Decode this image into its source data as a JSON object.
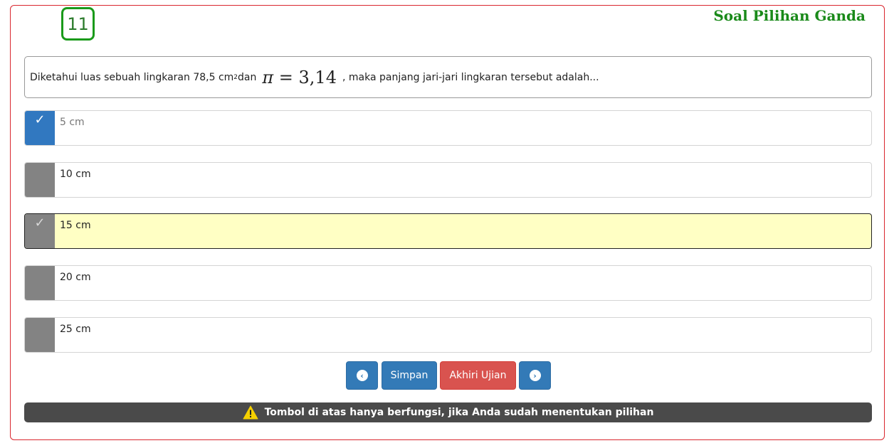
{
  "question_number": "11",
  "page_title": "Soal Pilihan Ganda",
  "question": {
    "text_before": "Diketahui luas sebuah lingkaran 78,5 cm",
    "superscript": "2",
    "text_dan": " dan",
    "math_pi": "π",
    "math_rest": " = 3,14",
    "text_after": ", maka panjang jari-jari lingkaran tersebut adalah..."
  },
  "options": [
    {
      "label": "5 cm",
      "state": "selected"
    },
    {
      "label": "10 cm",
      "state": "normal"
    },
    {
      "label": "15 cm",
      "state": "highlight"
    },
    {
      "label": "20 cm",
      "state": "normal"
    },
    {
      "label": "25 cm",
      "state": "normal"
    }
  ],
  "check_glyph": "✓",
  "buttons": {
    "prev_icon": "chevron-left-icon",
    "prev_glyph": "‹",
    "save_label": "Simpan",
    "end_label": "Akhiri Ujian",
    "next_icon": "chevron-right-icon",
    "next_glyph": "›"
  },
  "notice": {
    "icon": "warning-icon",
    "text": "Tombol di atas hanya berfungsi, jika Anda sudah menentukan pilihan"
  },
  "colors": {
    "frame_border": "#d9262e",
    "title_green": "#1a8a1a",
    "selected_blue": "#3178c0",
    "highlight_yellow": "#ffffc4",
    "button_blue": "#337ab7",
    "button_red": "#d9534f",
    "notice_bg": "#4a4a4a"
  }
}
